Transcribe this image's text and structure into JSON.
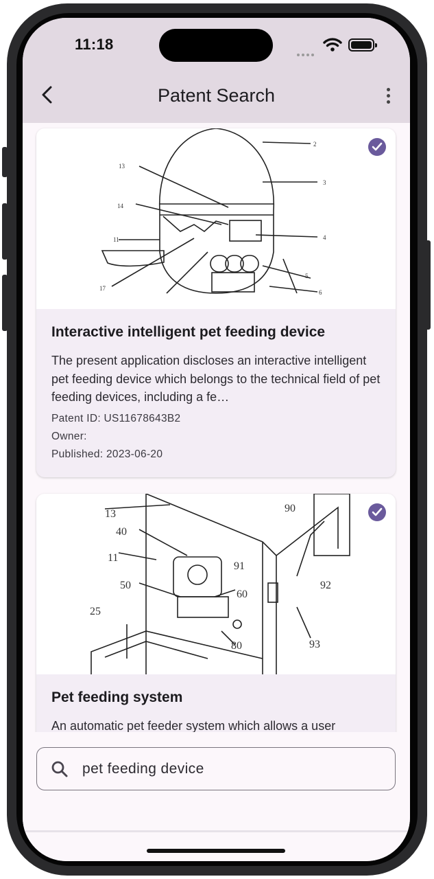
{
  "status_bar": {
    "time": "11:18"
  },
  "app_bar": {
    "title": "Patent Search",
    "back_icon": "chevron-left-icon",
    "menu_icon": "more-vertical-icon"
  },
  "results": [
    {
      "title": "Interactive intelligent pet feeding device",
      "description": "The present application discloses an interactive intelligent pet feeding device which belongs to the technical field of pet feeding devices, including a fe…",
      "patent_id": "Patent ID: US11678643B2",
      "owner": "Owner:",
      "published": "Published: 2023-06-20",
      "selected": true
    },
    {
      "title": "Pet feeding system",
      "description": "An automatic pet feeder system which allows a user",
      "selected": true
    }
  ],
  "search": {
    "value": "pet feeding device",
    "icon": "search-icon"
  },
  "colors": {
    "appbar_bg": "#e2d9e2",
    "card_bg": "#f3edf5",
    "check_accent": "#6a5a9c",
    "page_bg": "#fcf7fb"
  }
}
